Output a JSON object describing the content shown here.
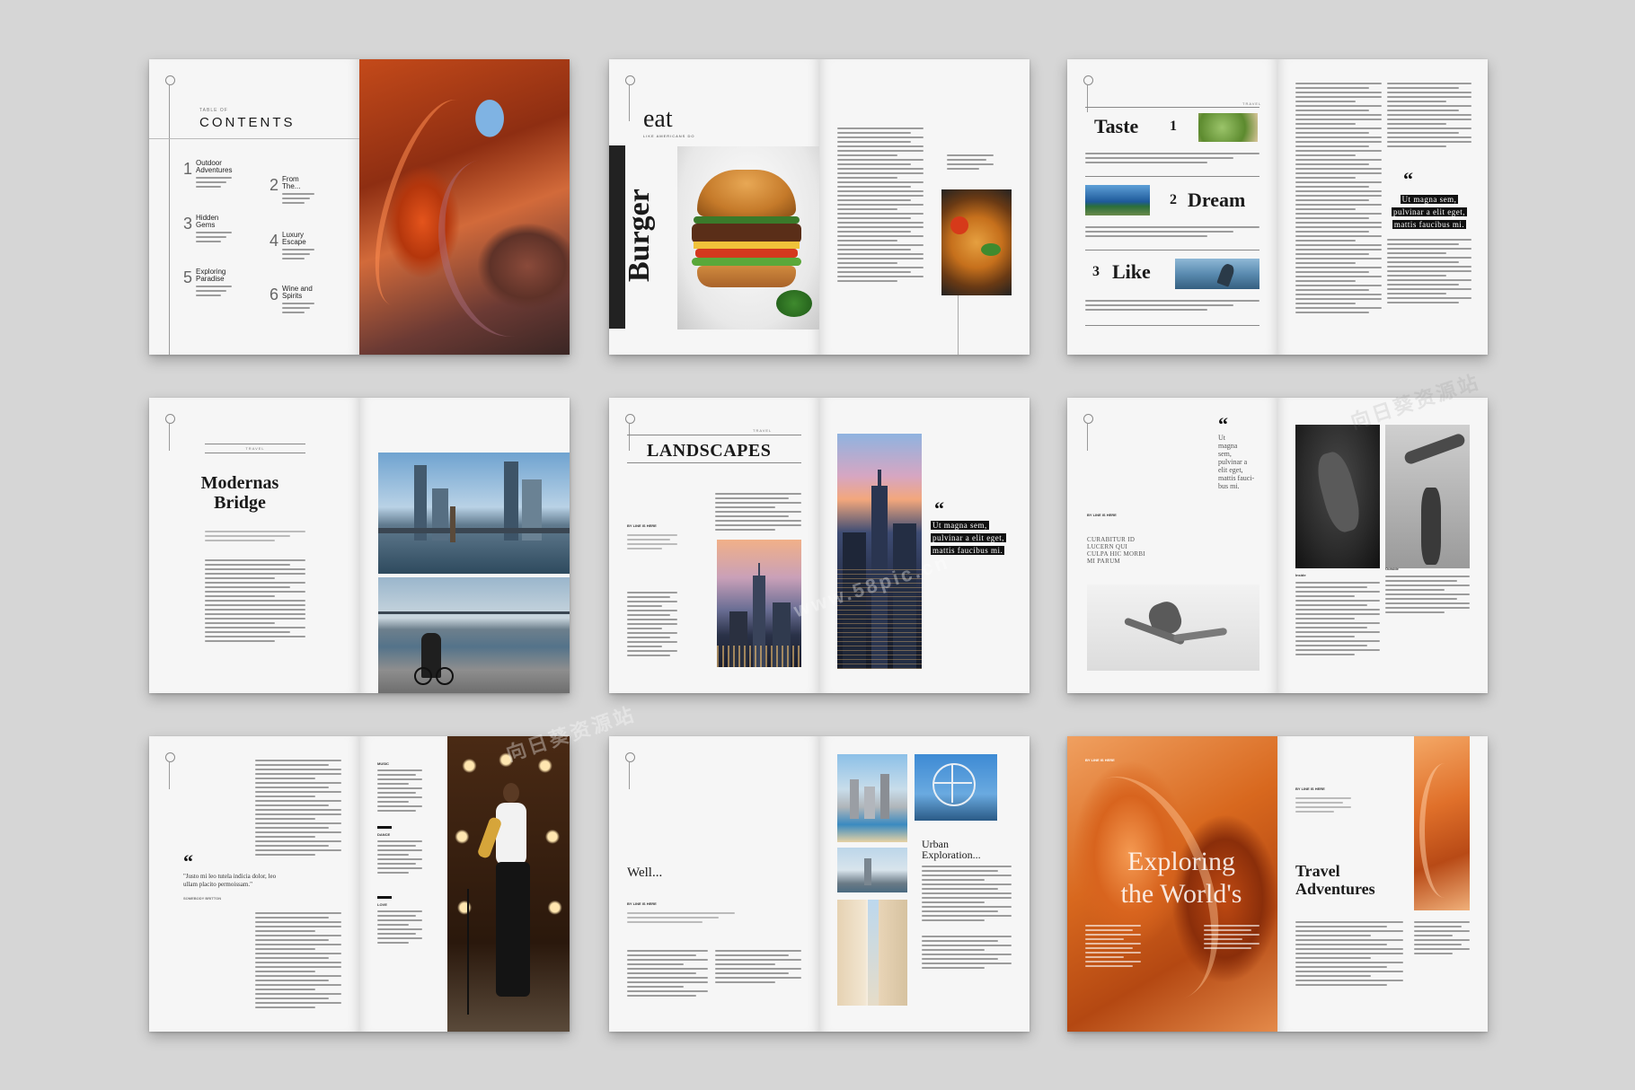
{
  "spreads": {
    "toc": {
      "kicker": "TABLE OF",
      "title": "CONTENTS",
      "items": [
        {
          "num": "1",
          "title1": "Outdoor",
          "title2": "Adventures"
        },
        {
          "num": "2",
          "title1": "From",
          "title2": "The..."
        },
        {
          "num": "3",
          "title1": "Hidden",
          "title2": "Gems"
        },
        {
          "num": "4",
          "title1": "Luxury",
          "title2": "Escape"
        },
        {
          "num": "5",
          "title1": "Exploring",
          "title2": "Paradise"
        },
        {
          "num": "6",
          "title1": "Wine and",
          "title2": "Spirits"
        }
      ]
    },
    "eat": {
      "title": "eat",
      "subtitle": "LIKE AMERICANS DO",
      "vertical": "Burger"
    },
    "taste": {
      "kicker": "TRAVEL",
      "rows": [
        {
          "word": "Taste",
          "num": "1"
        },
        {
          "num": "2",
          "word": "Dream"
        },
        {
          "num": "3",
          "word": "Like"
        }
      ],
      "quote_lines": [
        "Ut magna sem,",
        "pulvinar a elit eget,",
        "mattis faucibus mi."
      ]
    },
    "bridge": {
      "kicker": "TRAVEL",
      "title1": "Modernas",
      "title2": "Bridge"
    },
    "landscapes": {
      "kicker": "TRAVEL",
      "title": "LANDSCAPES",
      "byline": "BY LINE IS HERE",
      "quote_lines": [
        "Ut magna sem,",
        "pulvinar a elit eget,",
        "mattis faucibus mi."
      ]
    },
    "dance": {
      "quote_lines": [
        "Ut",
        "magna",
        "sem,",
        "pulvinar a",
        "elit eget,",
        "mattis fauci-",
        "bus mi."
      ],
      "byline": "BY LINE IS HERE",
      "headline_lines": [
        "CURABITUR ID",
        "LUCERN QUI",
        "CULPA HIC MORBI",
        "MI PARUM"
      ],
      "label_inside": "Inside",
      "label_outside": "Outside"
    },
    "music": {
      "quote": "\"Justo mi leo tutela indicia dolor, leo ullam placito permoissam.\"",
      "cite": "SOMEBODY BRITTON",
      "sections": [
        "MUSIC",
        "DANCE",
        "LOVE"
      ]
    },
    "well": {
      "title": "Well...",
      "byline": "BY LINE IS HERE",
      "heading1": "Urban",
      "heading2": "Exploration..."
    },
    "explore": {
      "byline_left": "BY LINE IS HERE",
      "title1": "Exploring",
      "title2": "the World's",
      "byline_right": "BY LINE IS HERE",
      "heading1": "Travel",
      "heading2": "Adventures"
    }
  },
  "watermark": {
    "site": "www.58pic.cn",
    "brand": "向日葵资源站"
  }
}
